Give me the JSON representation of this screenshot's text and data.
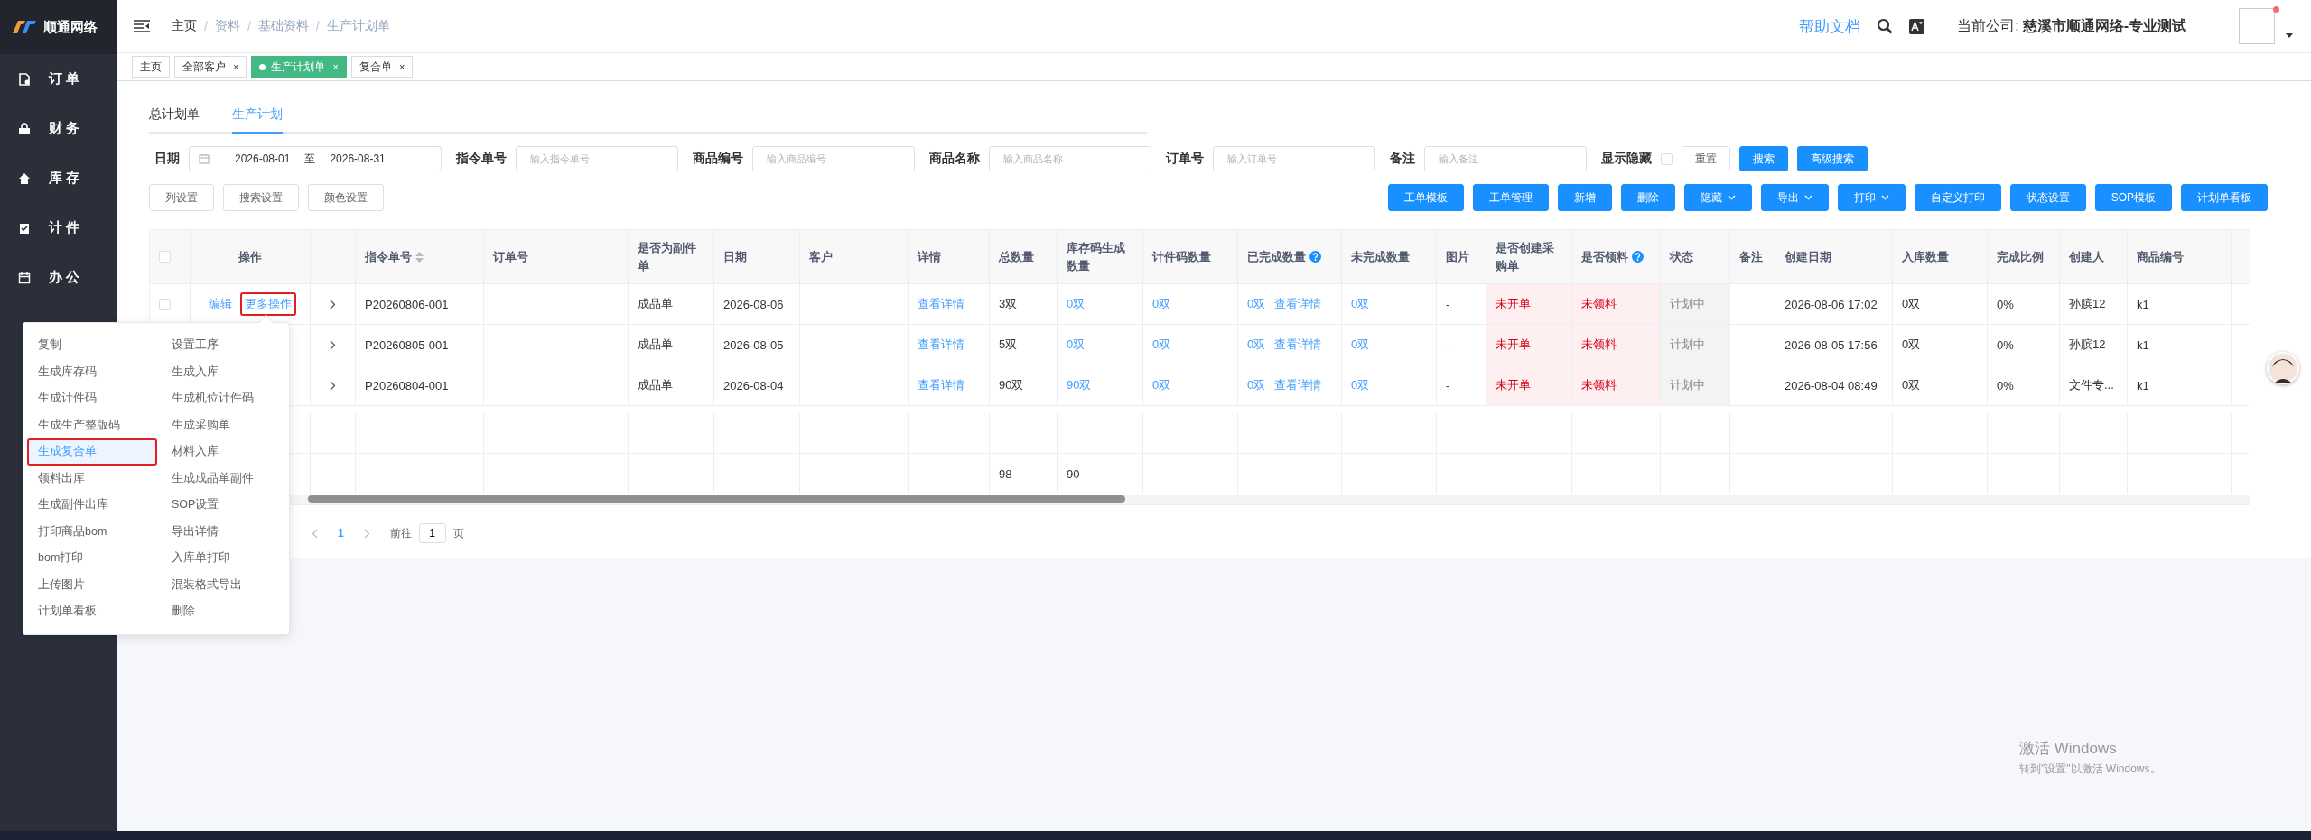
{
  "app": {
    "logo_text": "顺通网络"
  },
  "sidebar": {
    "items": [
      {
        "label": "订 单"
      },
      {
        "label": "财 务"
      },
      {
        "label": "库 存"
      },
      {
        "label": "计 件"
      },
      {
        "label": "办 公"
      }
    ]
  },
  "header": {
    "breadcrumbs": [
      {
        "label": "主页"
      },
      {
        "separator": "/",
        "label": "资料"
      },
      {
        "separator": "/",
        "label": "基础资料"
      },
      {
        "separator": "/",
        "label": "生产计划单"
      }
    ],
    "help": "帮助文档",
    "company_label": "当前公司:",
    "company": "慈溪市顺通网络-专业测试",
    "notification": true
  },
  "tags": [
    {
      "label": "主页",
      "selected": false
    },
    {
      "label": "全部客户",
      "close": "×",
      "selected": false
    },
    {
      "label": "生产计划单",
      "close": "×",
      "selected": true
    },
    {
      "label": "复合单",
      "close": "×",
      "selected": false
    }
  ],
  "page_tabs": [
    {
      "label": "总计划单",
      "selected": false
    },
    {
      "label": "生产计划",
      "selected": true
    }
  ],
  "filters": [
    {
      "label": "日期",
      "kind": "daterange",
      "from": "2026-08-01",
      "separator": "至",
      "to": "2026-08-31"
    },
    {
      "label": "指令单号",
      "kind": "input",
      "placeholder": "输入指令单号"
    },
    {
      "label": "商品编号",
      "kind": "input",
      "placeholder": "输入商品编号"
    },
    {
      "label": "商品名称",
      "kind": "input",
      "placeholder": "输入商品名称"
    },
    {
      "label": "订单号",
      "kind": "input",
      "placeholder": "输入订单号"
    },
    {
      "label": "备注",
      "kind": "input",
      "placeholder": "输入备注"
    },
    {
      "label": "显示隐藏",
      "kind": "checkbox",
      "checked": false
    }
  ],
  "filter_buttons": [
    {
      "label": "重置",
      "primary": false
    },
    {
      "label": "搜索",
      "primary": true
    },
    {
      "label": "高级搜索",
      "primary": true
    }
  ],
  "left_tools": [
    "列设置",
    "搜索设置",
    "颜色设置"
  ],
  "right_tools": [
    {
      "label": "工单模板",
      "dropdown": false
    },
    {
      "label": "工单管理",
      "dropdown": false
    },
    {
      "label": "新增",
      "dropdown": false
    },
    {
      "label": "删除",
      "dropdown": false
    },
    {
      "label": "隐藏",
      "dropdown": true
    },
    {
      "label": "导出",
      "dropdown": true
    },
    {
      "label": "打印",
      "dropdown": true
    },
    {
      "label": "自定义打印",
      "dropdown": false
    },
    {
      "label": "状态设置",
      "dropdown": false
    },
    {
      "label": "SOP模板",
      "dropdown": false
    },
    {
      "label": "计划单看板",
      "dropdown": false
    }
  ],
  "table": {
    "select_all_checked": false,
    "ops_header": "操作",
    "columns": [
      {
        "label": "指令单号",
        "kind": "sortable"
      },
      {
        "label": "订单号",
        "kind": "plain"
      },
      {
        "label": "是否为副件单",
        "kind": "plain"
      },
      {
        "label": "日期",
        "kind": "plain"
      },
      {
        "label": "客户",
        "kind": "plain"
      },
      {
        "label": "详情",
        "kind": "plain"
      },
      {
        "label": "总数量",
        "kind": "plain"
      },
      {
        "label": "库存码生成数量",
        "kind": "plain"
      },
      {
        "label": "计件码数量",
        "kind": "plain"
      },
      {
        "label": "已完成数量",
        "kind": "help"
      },
      {
        "label": "未完成数量",
        "kind": "plain"
      },
      {
        "label": "图片",
        "kind": "plain"
      },
      {
        "label": "是否创建采购单",
        "kind": "plain"
      },
      {
        "label": "是否领料",
        "kind": "help"
      },
      {
        "label": "状态",
        "kind": "plain"
      },
      {
        "label": "备注",
        "kind": "plain"
      },
      {
        "label": "创建日期",
        "kind": "plain"
      },
      {
        "label": "入库数量",
        "kind": "plain"
      },
      {
        "label": "完成比例",
        "kind": "plain"
      },
      {
        "label": "创建人",
        "kind": "plain"
      },
      {
        "label": "商品编号",
        "kind": "plain"
      }
    ],
    "rows": [
      {
        "checked": false,
        "actions": [
          {
            "label": "编辑",
            "highlighted": false
          },
          {
            "label": "更多操作",
            "highlighted": true
          }
        ],
        "cells": [
          {
            "kind": "text",
            "text": "P20260806-001"
          },
          {
            "kind": "empty"
          },
          {
            "kind": "text",
            "text": "成品单"
          },
          {
            "kind": "text",
            "text": "2026-08-06"
          },
          {
            "kind": "empty"
          },
          {
            "kind": "link",
            "text": "查看详情"
          },
          {
            "kind": "text",
            "text": "3双"
          },
          {
            "kind": "link",
            "text": "0双"
          },
          {
            "kind": "link",
            "text": "0双"
          },
          {
            "kind": "links",
            "texts": [
              "0双",
              "查看详情"
            ]
          },
          {
            "kind": "link",
            "text": "0双"
          },
          {
            "kind": "text",
            "text": "-"
          },
          {
            "kind": "alert",
            "text": "未开单"
          },
          {
            "kind": "alert",
            "text": "未领料"
          },
          {
            "kind": "muted",
            "text": "计划中"
          },
          {
            "kind": "empty"
          },
          {
            "kind": "text",
            "text": "2026-08-06 17:02"
          },
          {
            "kind": "text",
            "text": "0双"
          },
          {
            "kind": "text",
            "text": "0%"
          },
          {
            "kind": "text",
            "text": "孙膑12"
          },
          {
            "kind": "text",
            "text": "k1"
          }
        ]
      },
      {
        "cells": [
          {
            "kind": "text",
            "text": "P20260805-001"
          },
          {
            "kind": "empty"
          },
          {
            "kind": "text",
            "text": "成品单"
          },
          {
            "kind": "text",
            "text": "2026-08-05"
          },
          {
            "kind": "empty"
          },
          {
            "kind": "link",
            "text": "查看详情"
          },
          {
            "kind": "text",
            "text": "5双"
          },
          {
            "kind": "link",
            "text": "0双"
          },
          {
            "kind": "link",
            "text": "0双"
          },
          {
            "kind": "links",
            "texts": [
              "0双",
              "查看详情"
            ]
          },
          {
            "kind": "link",
            "text": "0双"
          },
          {
            "kind": "text",
            "text": "-"
          },
          {
            "kind": "alert",
            "text": "未开单"
          },
          {
            "kind": "alert",
            "text": "未领料"
          },
          {
            "kind": "muted",
            "text": "计划中"
          },
          {
            "kind": "empty"
          },
          {
            "kind": "text",
            "text": "2026-08-05 17:56"
          },
          {
            "kind": "text",
            "text": "0双"
          },
          {
            "kind": "text",
            "text": "0%"
          },
          {
            "kind": "text",
            "text": "孙膑12"
          },
          {
            "kind": "text",
            "text": "k1"
          }
        ]
      },
      {
        "cells": [
          {
            "kind": "text",
            "text": "P20260804-001"
          },
          {
            "kind": "empty"
          },
          {
            "kind": "text",
            "text": "成品单"
          },
          {
            "kind": "text",
            "text": "2026-08-04"
          },
          {
            "kind": "empty"
          },
          {
            "kind": "link",
            "text": "查看详情"
          },
          {
            "kind": "text",
            "text": "90双"
          },
          {
            "kind": "link",
            "text": "90双"
          },
          {
            "kind": "link",
            "text": "0双"
          },
          {
            "kind": "links",
            "texts": [
              "0双",
              "查看详情"
            ]
          },
          {
            "kind": "link",
            "text": "0双"
          },
          {
            "kind": "text",
            "text": "-"
          },
          {
            "kind": "alert",
            "text": "未开单"
          },
          {
            "kind": "alert",
            "text": "未领料"
          },
          {
            "kind": "muted",
            "text": "计划中"
          },
          {
            "kind": "empty"
          },
          {
            "kind": "text",
            "text": "2026-08-04 08:49"
          },
          {
            "kind": "text",
            "text": "0双"
          },
          {
            "kind": "text",
            "text": "0%"
          },
          {
            "kind": "text",
            "text": "文件专..."
          },
          {
            "kind": "text",
            "text": "k1"
          }
        ]
      }
    ],
    "summary": [
      {
        "kind": "empty"
      },
      {
        "kind": "empty"
      },
      {
        "kind": "empty"
      },
      {
        "kind": "empty"
      },
      {
        "kind": "empty"
      },
      {
        "kind": "empty"
      },
      {
        "kind": "text",
        "text": "98"
      },
      {
        "kind": "text",
        "text": "90"
      },
      {
        "kind": "empty"
      },
      {
        "kind": "empty"
      },
      {
        "kind": "empty"
      },
      {
        "kind": "empty"
      },
      {
        "kind": "empty"
      },
      {
        "kind": "empty"
      },
      {
        "kind": "empty"
      },
      {
        "kind": "empty"
      },
      {
        "kind": "empty"
      },
      {
        "kind": "empty"
      },
      {
        "kind": "empty"
      },
      {
        "kind": "empty"
      },
      {
        "kind": "empty"
      }
    ]
  },
  "pagination": {
    "current": "1",
    "goto_label": "前往",
    "goto_value": "1",
    "goto_suffix": "页"
  },
  "context_menu": {
    "items": [
      {
        "label": "复制",
        "selected": false
      },
      {
        "label": "设置工序",
        "selected": false
      },
      {
        "label": "生成库存码",
        "selected": false
      },
      {
        "label": "生成入库",
        "selected": false
      },
      {
        "label": "生成计件码",
        "selected": false
      },
      {
        "label": "生成机位计件码",
        "selected": false
      },
      {
        "label": "生成生产整版码",
        "selected": false
      },
      {
        "label": "生成采购单",
        "selected": false
      },
      {
        "label": "生成复合单",
        "selected": true
      },
      {
        "label": "材料入库",
        "selected": false
      },
      {
        "label": "领料出库",
        "selected": false
      },
      {
        "label": "生成成品单副件",
        "selected": false
      },
      {
        "label": "生成副件出库",
        "selected": false
      },
      {
        "label": "SOP设置",
        "selected": false
      },
      {
        "label": "打印商品bom",
        "selected": false
      },
      {
        "label": "导出详情",
        "selected": false
      },
      {
        "label": "bom打印",
        "selected": false
      },
      {
        "label": "入库单打印",
        "selected": false
      },
      {
        "label": "上传图片",
        "selected": false
      },
      {
        "label": "混装格式导出",
        "selected": false
      },
      {
        "label": "计划单看板",
        "selected": false
      },
      {
        "label": "删除",
        "selected": false
      }
    ]
  },
  "os_notice": {
    "title": "激活 Windows",
    "text": "转到\"设置\"以激活 Windows。"
  }
}
